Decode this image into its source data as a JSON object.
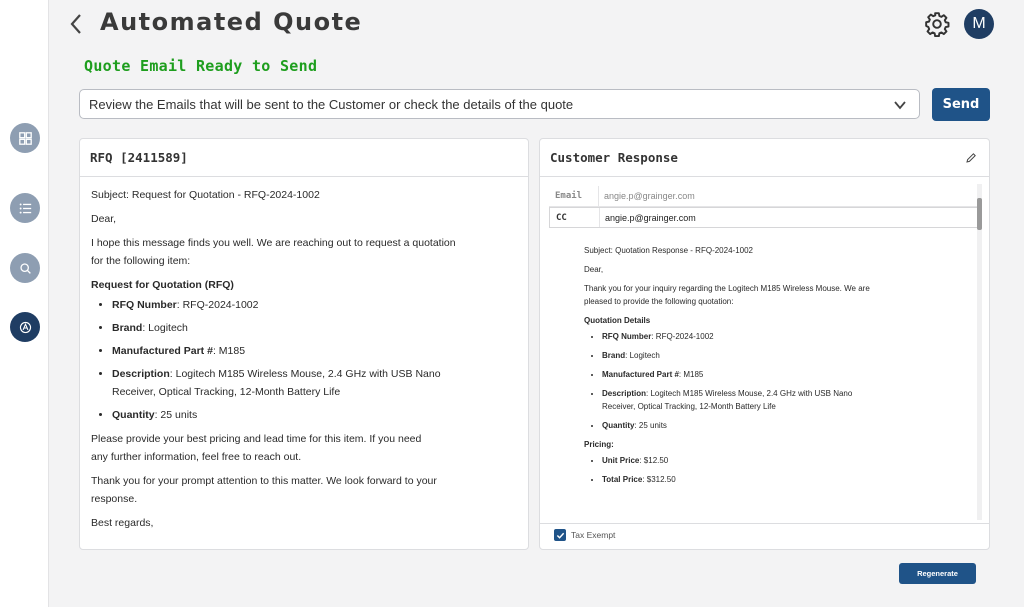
{
  "header": {
    "title": "Automated Quote",
    "avatar_initial": "M"
  },
  "status": {
    "ready_text": "Quote Email Ready to Send"
  },
  "selector": {
    "selected": "Review the Emails that will be sent to the Customer or check the details of the quote"
  },
  "actions": {
    "send_label": "Send",
    "regenerate_label": "Regenerate"
  },
  "colors": {
    "accent": "#1f5388",
    "ready_green": "#1e9e1e",
    "nav_active": "#1f3d63"
  },
  "sidebar": {
    "items": [
      {
        "icon": "dashboard-icon"
      },
      {
        "icon": "list-icon"
      },
      {
        "icon": "search-icon"
      },
      {
        "icon": "automation-icon",
        "active": true
      }
    ]
  },
  "rfq": {
    "title": "RFQ [2411589]",
    "subject": "Subject: Request for Quotation - RFQ-2024-1002",
    "greeting": "Dear,",
    "intro": "I hope this message finds you well. We are reaching out to request a quotation for the following item:",
    "section": "Request for Quotation (RFQ)",
    "items": [
      {
        "label": "RFQ Number",
        "value": ": RFQ-2024-1002"
      },
      {
        "label": "Brand",
        "value": ": Logitech"
      },
      {
        "label": "Manufactured Part #",
        "value": ": M185"
      },
      {
        "label": "Description",
        "value": ": Logitech M185 Wireless Mouse, 2.4 GHz with USB Nano Receiver, Optical Tracking, 12-Month Battery Life"
      },
      {
        "label": "Quantity",
        "value": ": 25 units"
      }
    ],
    "para1": "Please provide your best pricing and lead time for this item. If you need any further information, feel free to reach out.",
    "para2": "Thank you for your prompt attention to this matter. We look forward to your response.",
    "closing": "Best regards,"
  },
  "response": {
    "title": "Customer Response",
    "email_label": "Email",
    "email_value": "angie.p@grainger.com",
    "cc_label": "CC",
    "cc_value": "angie.p@grainger.com",
    "subject": "Subject: Quotation Response - RFQ-2024-1002",
    "greeting": "Dear,",
    "intro": "Thank you for your inquiry regarding the Logitech M185 Wireless Mouse. We are pleased to provide the following quotation:",
    "details_heading": "Quotation Details",
    "items": [
      {
        "label": "RFQ Number",
        "value": ": RFQ-2024-1002"
      },
      {
        "label": "Brand",
        "value": ": Logitech"
      },
      {
        "label": "Manufactured Part #",
        "value": ": M185"
      },
      {
        "label": "Description",
        "value": ": Logitech M185 Wireless Mouse, 2.4 GHz with USB Nano Receiver, Optical Tracking, 12-Month Battery Life"
      },
      {
        "label": "Quantity",
        "value": ": 25 units"
      }
    ],
    "pricing_heading": "Pricing:",
    "pricing": [
      {
        "label": "Unit Price",
        "value": ": $12.50"
      },
      {
        "label": "Total Price",
        "value": ": $312.50"
      }
    ],
    "tax_label": "Tax Exempt",
    "tax_checked": true
  }
}
